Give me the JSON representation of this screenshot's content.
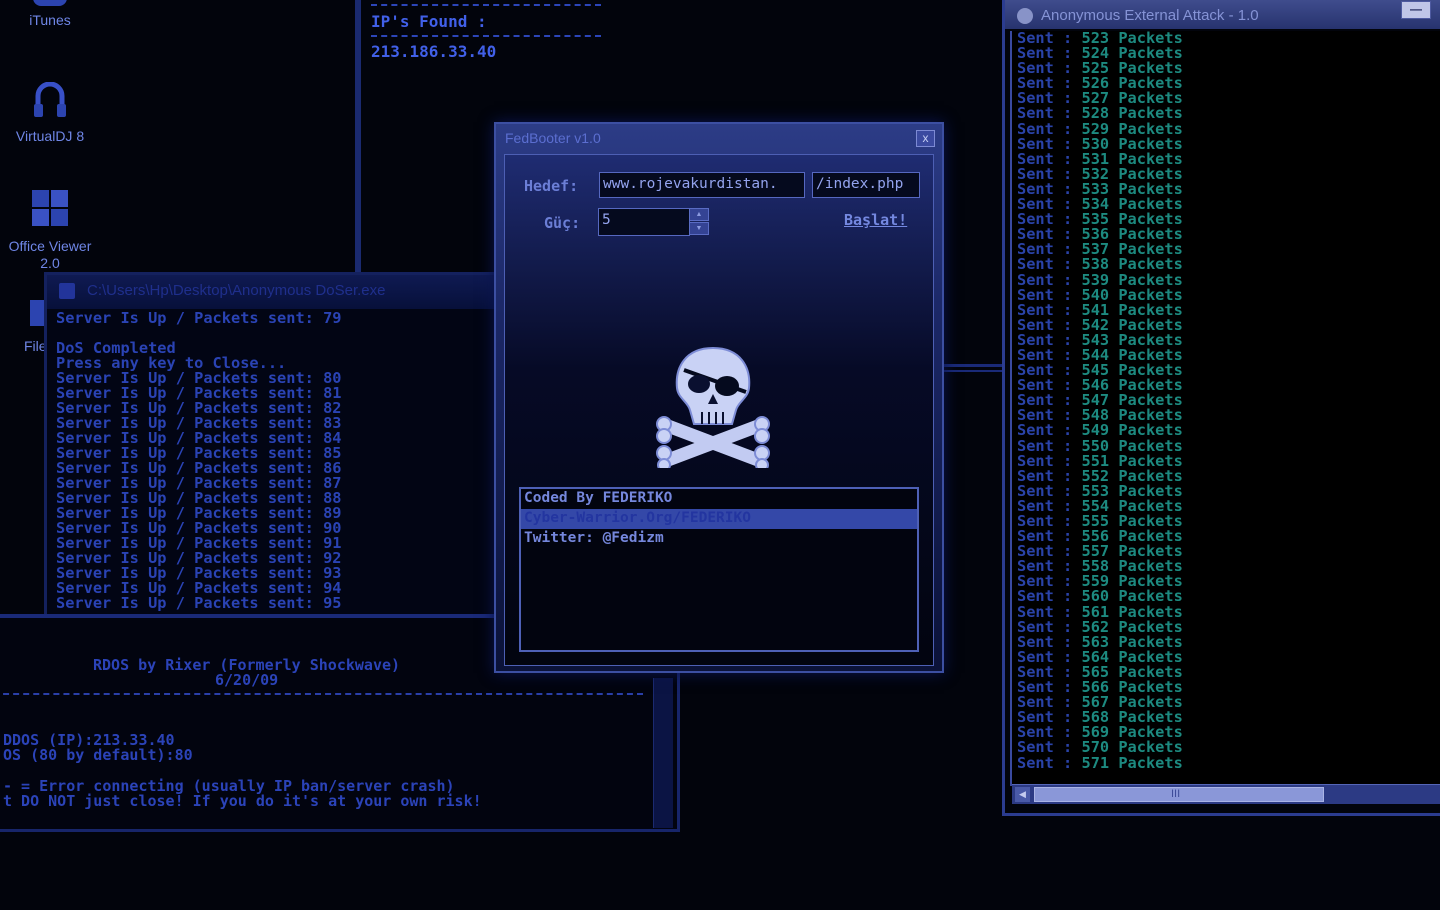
{
  "desktop": {
    "icons": [
      {
        "label": "iTunes",
        "icon": "itunes-icon"
      },
      {
        "label": "VirtualDJ 8",
        "icon": "virtualdj-icon"
      },
      {
        "label": "Office Viewer 2.0",
        "icon": "office-viewer-icon"
      },
      {
        "label": "File",
        "icon": "file-icon"
      }
    ]
  },
  "ip_window": {
    "heading": "IP's Found :",
    "ip": "213.186.33.40"
  },
  "dos_window": {
    "title": "C:\\Users\\Hp\\Desktop\\Anonymous DoSer.exe",
    "lines": [
      "Server Is Up / Packets sent: 79",
      "",
      "DoS Completed",
      "Press any key to Close...",
      "Server Is Up / Packets sent: 80",
      "Server Is Up / Packets sent: 81",
      "Server Is Up / Packets sent: 82",
      "Server Is Up / Packets sent: 83",
      "Server Is Up / Packets sent: 84",
      "Server Is Up / Packets sent: 85",
      "Server Is Up / Packets sent: 86",
      "Server Is Up / Packets sent: 87",
      "Server Is Up / Packets sent: 88",
      "Server Is Up / Packets sent: 89",
      "Server Is Up / Packets sent: 90",
      "Server Is Up / Packets sent: 91",
      "Server Is Up / Packets sent: 92",
      "Server Is Up / Packets sent: 93",
      "Server Is Up / Packets sent: 94",
      "Server Is Up / Packets sent: 95"
    ]
  },
  "ddos_window": {
    "banner": "RDOS by Rixer (Formerly Shockwave)",
    "date": "6/20/09",
    "prompt_ip": "DDOS (IP):213.33.40",
    "prompt_port": "OS (80 by default):80",
    "note_error": "- = Error connecting (usually IP ban/server crash)",
    "note_close": "t DO NOT just close! If you do it's at your own risk!"
  },
  "fedbooter": {
    "title": "FedBooter v1.0",
    "close_label": "x",
    "target_label": "Hedef:",
    "target_host": "www.rojevakurdistan.",
    "target_path": "/index.php",
    "power_label": "Güç:",
    "power_value": "5",
    "start_label": "Başlat!",
    "logo_icon": "skull-crossbones-icon",
    "credits": [
      "Coded By FEDERIKO",
      "Cyber-Warrior.Org/FEDERIKO",
      "Twitter: @Fedizm"
    ],
    "selected_credit": 1
  },
  "attack_window": {
    "title": "Anonymous External Attack - 1.0",
    "minimize_label": "—",
    "scroll_grip": "III",
    "log": [
      {
        "label": "Sent :",
        "value": "523 Packets"
      },
      {
        "label": "Sent :",
        "value": "524 Packets"
      },
      {
        "label": "Sent :",
        "value": "525 Packets"
      },
      {
        "label": "Sent :",
        "value": "526 Packets"
      },
      {
        "label": "Sent :",
        "value": "527 Packets"
      },
      {
        "label": "Sent :",
        "value": "528 Packets"
      },
      {
        "label": "Sent :",
        "value": "529 Packets"
      },
      {
        "label": "Sent :",
        "value": "530 Packets"
      },
      {
        "label": "Sent :",
        "value": "531 Packets"
      },
      {
        "label": "Sent :",
        "value": "532 Packets"
      },
      {
        "label": "Sent :",
        "value": "533 Packets"
      },
      {
        "label": "Sent :",
        "value": "534 Packets"
      },
      {
        "label": "Sent :",
        "value": "535 Packets"
      },
      {
        "label": "Sent :",
        "value": "536 Packets"
      },
      {
        "label": "Sent :",
        "value": "537 Packets"
      },
      {
        "label": "Sent :",
        "value": "538 Packets"
      },
      {
        "label": "Sent :",
        "value": "539 Packets"
      },
      {
        "label": "Sent :",
        "value": "540 Packets"
      },
      {
        "label": "Sent :",
        "value": "541 Packets"
      },
      {
        "label": "Sent :",
        "value": "542 Packets"
      },
      {
        "label": "Sent :",
        "value": "543 Packets"
      },
      {
        "label": "Sent :",
        "value": "544 Packets"
      },
      {
        "label": "Sent :",
        "value": "545 Packets"
      },
      {
        "label": "Sent :",
        "value": "546 Packets"
      },
      {
        "label": "Sent :",
        "value": "547 Packets"
      },
      {
        "label": "Sent :",
        "value": "548 Packets"
      },
      {
        "label": "Sent :",
        "value": "549 Packets"
      },
      {
        "label": "Sent :",
        "value": "550 Packets"
      },
      {
        "label": "Sent :",
        "value": "551 Packets"
      },
      {
        "label": "Sent :",
        "value": "552 Packets"
      },
      {
        "label": "Sent :",
        "value": "553 Packets"
      },
      {
        "label": "Sent :",
        "value": "554 Packets"
      },
      {
        "label": "Sent :",
        "value": "555 Packets"
      },
      {
        "label": "Sent :",
        "value": "556 Packets"
      },
      {
        "label": "Sent :",
        "value": "557 Packets"
      },
      {
        "label": "Sent :",
        "value": "558 Packets"
      },
      {
        "label": "Sent :",
        "value": "559 Packets"
      },
      {
        "label": "Sent :",
        "value": "560 Packets"
      },
      {
        "label": "Sent :",
        "value": "561 Packets"
      },
      {
        "label": "Sent :",
        "value": "562 Packets"
      },
      {
        "label": "Sent :",
        "value": "563 Packets"
      },
      {
        "label": "Sent :",
        "value": "564 Packets"
      },
      {
        "label": "Sent :",
        "value": "565 Packets"
      },
      {
        "label": "Sent :",
        "value": "566 Packets"
      },
      {
        "label": "Sent :",
        "value": "567 Packets"
      },
      {
        "label": "Sent :",
        "value": "568 Packets"
      },
      {
        "label": "Sent :",
        "value": "569 Packets"
      },
      {
        "label": "Sent :",
        "value": "570 Packets"
      },
      {
        "label": "Sent :",
        "value": "571 Packets"
      }
    ]
  },
  "colors": {
    "background": "#02040c",
    "console_text": "#2a43b4",
    "packet_value": "#1d8a80",
    "accent": "#3448a8"
  }
}
